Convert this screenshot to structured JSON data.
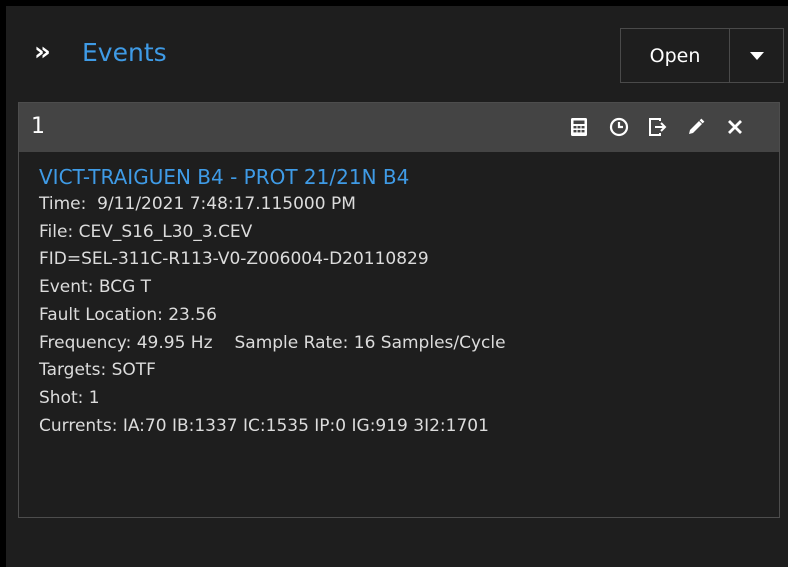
{
  "header": {
    "title": "Events",
    "open_label": "Open",
    "expand_icon": "double-chevron-right-icon",
    "dropdown_icon": "caret-down-icon"
  },
  "event_card": {
    "number": "1",
    "toolbar_icons": [
      "calculator-icon",
      "clock-icon",
      "export-icon",
      "pencil-icon",
      "close-icon"
    ],
    "title": "VICT-TRAIGUEN B4 - PROT 21/21N B4",
    "time": "Time:  9/11/2021 7:48:17.115000 PM",
    "file": "File: CEV_S16_L30_3.CEV",
    "fid": "FID=SEL-311C-R113-V0-Z006004-D20110829",
    "event": "Event: BCG T",
    "fault_location": "Fault Location: 23.56",
    "frequency": "Frequency: 49.95 Hz",
    "sample_rate": "Sample Rate: 16 Samples/Cycle",
    "targets": "Targets: SOTF",
    "shot": "Shot: 1",
    "currents": "Currents: IA:70 IB:1337 IC:1535 IP:0 IG:919 3I2:1701"
  },
  "colors": {
    "background": "#1e1e1e",
    "accent": "#3f9be6",
    "card_header": "#444444",
    "text": "#dcdcdc"
  }
}
